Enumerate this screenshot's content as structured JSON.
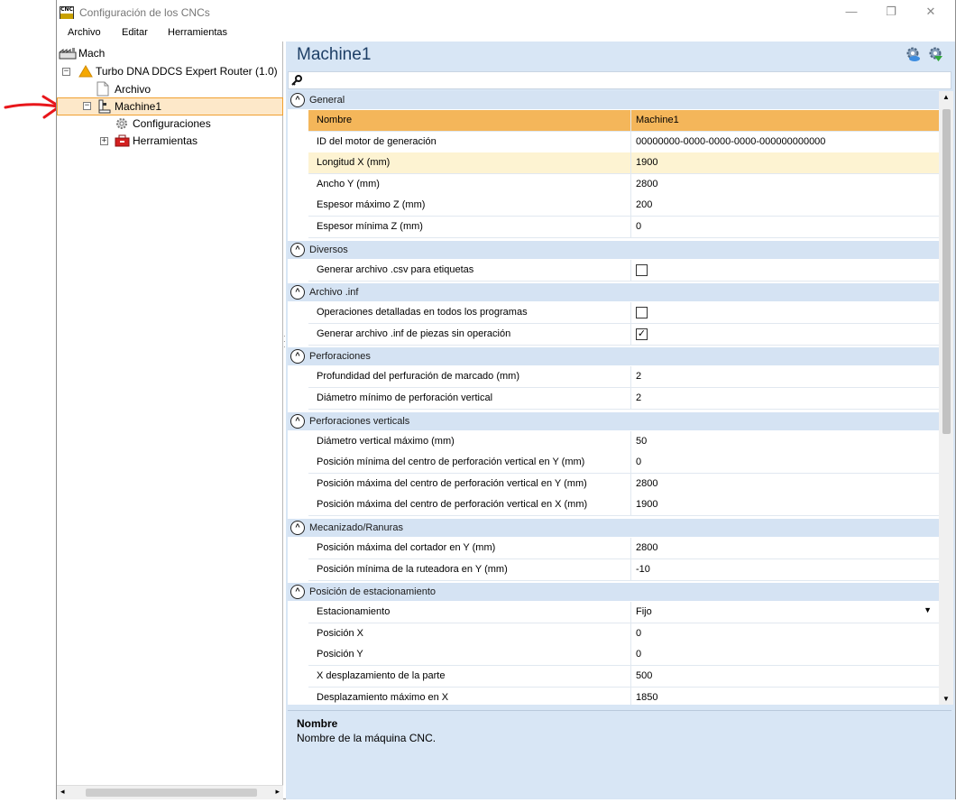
{
  "window": {
    "title": "Configuración de los CNCs",
    "icon_text": "CNC",
    "controls": {
      "minimize": "—",
      "restore": "❐",
      "close": "✕"
    }
  },
  "menu": [
    "Archivo",
    "Editar",
    "Herramientas"
  ],
  "tree": {
    "root": "Mach",
    "router": "Turbo DNA DDCS Expert Router (1.0)",
    "archivo": "Archivo",
    "machine": "Machine1",
    "configuraciones": "Configuraciones",
    "herramientas": "Herramientas"
  },
  "header": {
    "title": "Machine1",
    "icon_left": "gear-cloud-icon",
    "icon_right": "gear-green-icon"
  },
  "search": {
    "icon": "key-icon"
  },
  "categories": [
    {
      "label": "General",
      "rows": [
        {
          "name": "Nombre",
          "value": "Machine1",
          "state": "selected"
        },
        {
          "name": "ID del motor de generación",
          "value": "00000000-0000-0000-0000-000000000000"
        },
        {
          "name": "Longitud X (mm)",
          "value": "1900",
          "state": "hover"
        },
        {
          "name": "Ancho Y (mm)",
          "value": "2800"
        },
        {
          "name": "Espesor máximo Z (mm)",
          "value": "200"
        },
        {
          "name": "Espesor mínima Z (mm)",
          "value": "0"
        }
      ]
    },
    {
      "label": "Diversos",
      "rows": [
        {
          "name": "Generar archivo .csv para etiquetas",
          "type": "checkbox",
          "checked": false
        }
      ]
    },
    {
      "label": "Archivo .inf",
      "rows": [
        {
          "name": "Operaciones detalladas en todos los programas",
          "type": "checkbox",
          "checked": false
        },
        {
          "name": "Generar archivo .inf de piezas sin operación",
          "type": "checkbox",
          "checked": true
        }
      ]
    },
    {
      "label": "Perforaciones",
      "rows": [
        {
          "name": "Profundidad del perfuración de marcado (mm)",
          "value": "2"
        },
        {
          "name": "Diámetro mínimo de perforación vertical",
          "value": "2"
        }
      ]
    },
    {
      "label": "Perforaciones verticals",
      "rows": [
        {
          "name": "Diámetro vertical máximo (mm)",
          "value": "50"
        },
        {
          "name": "Posición mínima del centro de perforación vertical en Y (mm)",
          "value": "0"
        },
        {
          "name": "Posición máxima del centro de perforación vertical en Y (mm)",
          "value": "2800"
        },
        {
          "name": "Posición máxima del centro de perforación vertical en X (mm)",
          "value": "1900"
        }
      ]
    },
    {
      "label": "Mecanizado/Ranuras",
      "rows": [
        {
          "name": "Posición máxima del cortador en Y (mm)",
          "value": "2800"
        },
        {
          "name": "Posición mínima de la ruteadora en Y (mm)",
          "value": "-10"
        }
      ]
    },
    {
      "label": "Posición de estacionamiento",
      "rows": [
        {
          "name": "Estacionamiento",
          "value": "Fijo",
          "type": "dropdown"
        },
        {
          "name": "Posición X",
          "value": "0"
        },
        {
          "name": "Posición Y",
          "value": "0"
        },
        {
          "name": "X desplazamiento de la parte",
          "value": "500"
        },
        {
          "name": "Desplazamiento máximo en X",
          "value": "1850"
        }
      ]
    }
  ],
  "description": {
    "title": "Nombre",
    "text": "Nombre de la máquina CNC."
  },
  "colors": {
    "selected_row": "#f4b65a",
    "hover_row": "#fdf3d2",
    "category_bg": "#d5e3f3",
    "annotation_arrow": "#e8161b"
  }
}
